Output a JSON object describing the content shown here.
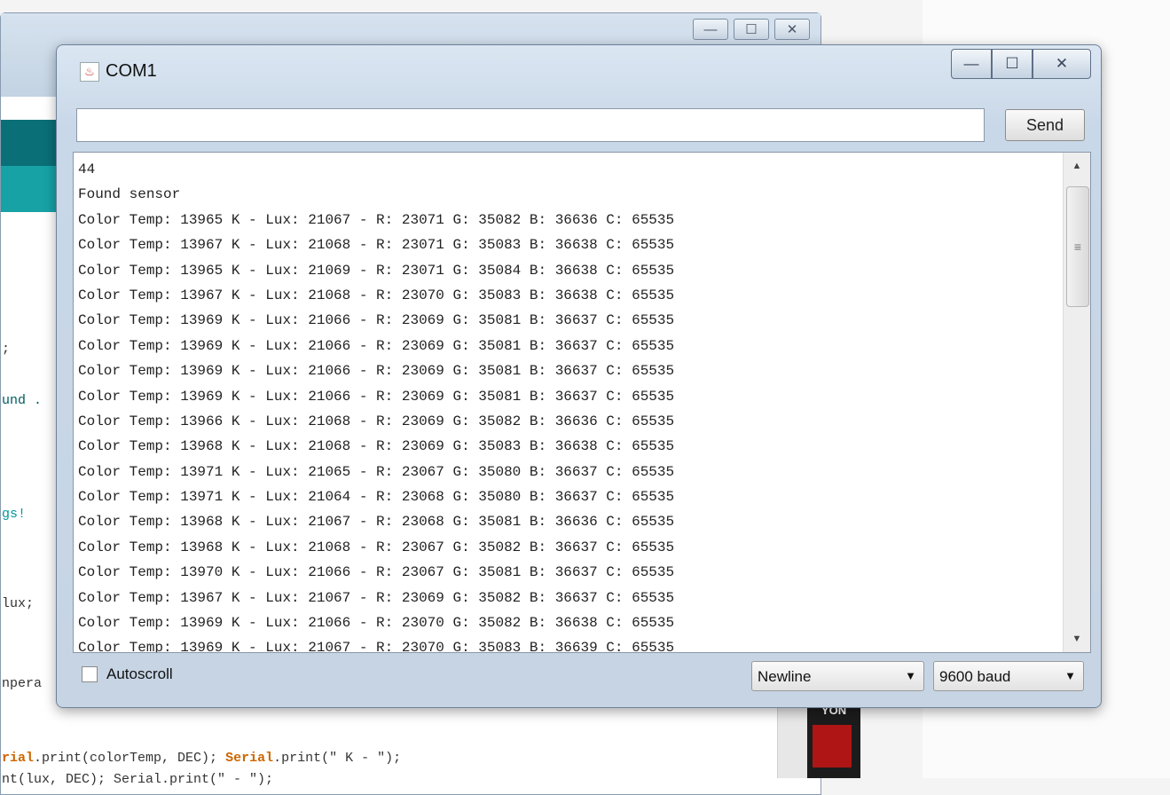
{
  "window": {
    "title": "COM1",
    "send_label": "Send",
    "input_value": "",
    "input_placeholder": "",
    "caption": {
      "minimize": "—",
      "maximize": "☐",
      "close": "✕"
    }
  },
  "output_lines": [
    "44",
    "Found sensor",
    "Color Temp: 13965 K - Lux: 21067 - R: 23071 G: 35082 B: 36636 C: 65535",
    "Color Temp: 13967 K - Lux: 21068 - R: 23071 G: 35083 B: 36638 C: 65535",
    "Color Temp: 13965 K - Lux: 21069 - R: 23071 G: 35084 B: 36638 C: 65535",
    "Color Temp: 13967 K - Lux: 21068 - R: 23070 G: 35083 B: 36638 C: 65535",
    "Color Temp: 13969 K - Lux: 21066 - R: 23069 G: 35081 B: 36637 C: 65535",
    "Color Temp: 13969 K - Lux: 21066 - R: 23069 G: 35081 B: 36637 C: 65535",
    "Color Temp: 13969 K - Lux: 21066 - R: 23069 G: 35081 B: 36637 C: 65535",
    "Color Temp: 13969 K - Lux: 21066 - R: 23069 G: 35081 B: 36637 C: 65535",
    "Color Temp: 13966 K - Lux: 21068 - R: 23069 G: 35082 B: 36636 C: 65535",
    "Color Temp: 13968 K - Lux: 21068 - R: 23069 G: 35083 B: 36638 C: 65535",
    "Color Temp: 13971 K - Lux: 21065 - R: 23067 G: 35080 B: 36637 C: 65535",
    "Color Temp: 13971 K - Lux: 21064 - R: 23068 G: 35080 B: 36637 C: 65535",
    "Color Temp: 13968 K - Lux: 21067 - R: 23068 G: 35081 B: 36636 C: 65535",
    "Color Temp: 13968 K - Lux: 21068 - R: 23067 G: 35082 B: 36637 C: 65535",
    "Color Temp: 13970 K - Lux: 21066 - R: 23067 G: 35081 B: 36637 C: 65535",
    "Color Temp: 13967 K - Lux: 21067 - R: 23069 G: 35082 B: 36637 C: 65535",
    "Color Temp: 13969 K - Lux: 21066 - R: 23070 G: 35082 B: 36638 C: 65535",
    "Color Temp: 13969 K - Lux: 21067 - R: 23070 G: 35083 B: 36639 C: 65535"
  ],
  "bottom": {
    "autoscroll_label": "Autoscroll",
    "autoscroll_checked": false,
    "line_ending": "Newline",
    "baud_rate": "9600 baud"
  },
  "background_editor": {
    "code_fragments": [
      ";",
      "und .",
      "gs!",
      "lux;",
      "npera"
    ],
    "code_line_1": {
      "fn1": "rial",
      "p1": ".print(colorTemp, DEC); ",
      "fn2": "Serial",
      "p2": ".print(\" K - \");"
    },
    "code_line_2": "nt(lux, DEC); Serial.print(\" - \");",
    "board_label": "YON"
  },
  "colors": {
    "teal_dark": "#0b6f77",
    "teal_light": "#17a2a6",
    "keyword": "#cc6600"
  }
}
